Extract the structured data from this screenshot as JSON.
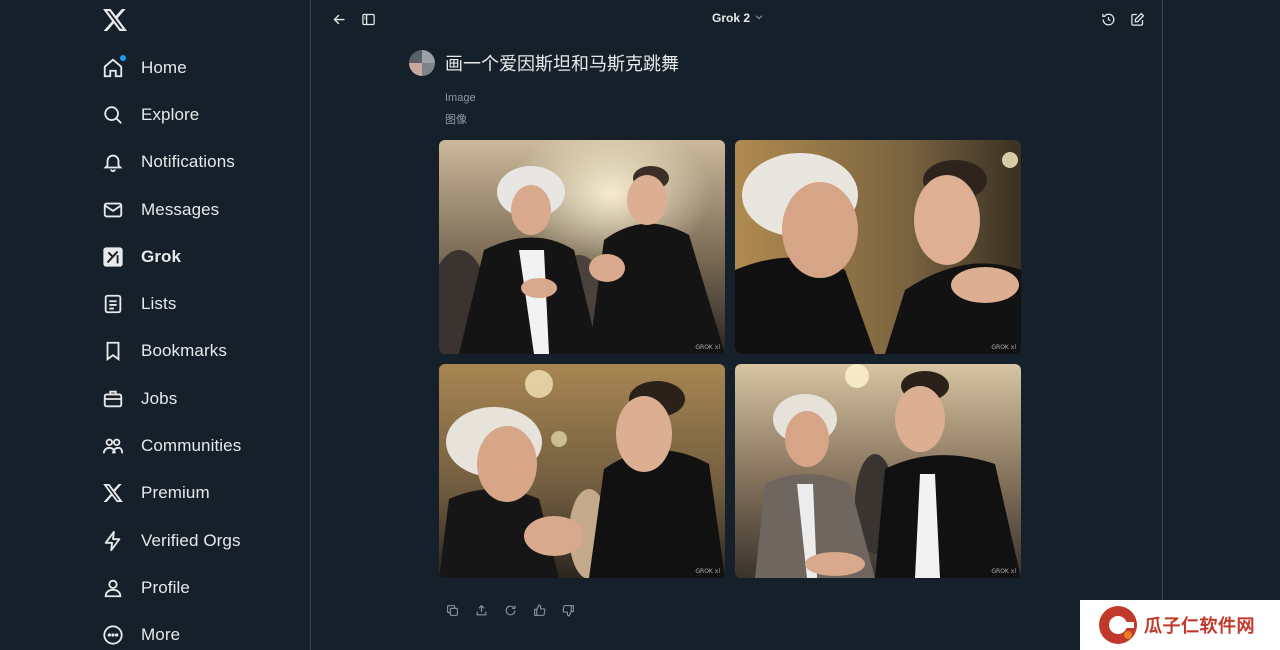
{
  "sidebar": {
    "logo": "x-logo-icon",
    "items": [
      {
        "label": "Home",
        "icon": "home-icon",
        "active": false
      },
      {
        "label": "Explore",
        "icon": "search-icon",
        "active": false
      },
      {
        "label": "Notifications",
        "icon": "bell-icon",
        "active": false
      },
      {
        "label": "Messages",
        "icon": "envelope-icon",
        "active": false
      },
      {
        "label": "Grok",
        "icon": "grok-icon",
        "active": true
      },
      {
        "label": "Lists",
        "icon": "list-icon",
        "active": false
      },
      {
        "label": "Bookmarks",
        "icon": "bookmark-icon",
        "active": false
      },
      {
        "label": "Jobs",
        "icon": "briefcase-icon",
        "active": false
      },
      {
        "label": "Communities",
        "icon": "people-icon",
        "active": false
      },
      {
        "label": "Premium",
        "icon": "x-logo-icon",
        "active": false
      },
      {
        "label": "Verified Orgs",
        "icon": "lightning-icon",
        "active": false
      },
      {
        "label": "Profile",
        "icon": "person-icon",
        "active": false
      },
      {
        "label": "More",
        "icon": "more-circle-icon",
        "active": false
      }
    ]
  },
  "topbar": {
    "model": "Grok 2"
  },
  "conversation": {
    "prompt": "画一个爱因斯坦和马斯克跳舞",
    "label_en": "Image",
    "label_zh": "图像",
    "image_watermark": "GROK xl"
  },
  "banner": {
    "text": "瓜子仁软件网"
  },
  "colors": {
    "background": "#15202b",
    "border": "#38444d",
    "text": "#e7e9ea",
    "muted": "#8b98a5",
    "accent": "#1d9bf0",
    "banner_red": "#c0392b"
  }
}
